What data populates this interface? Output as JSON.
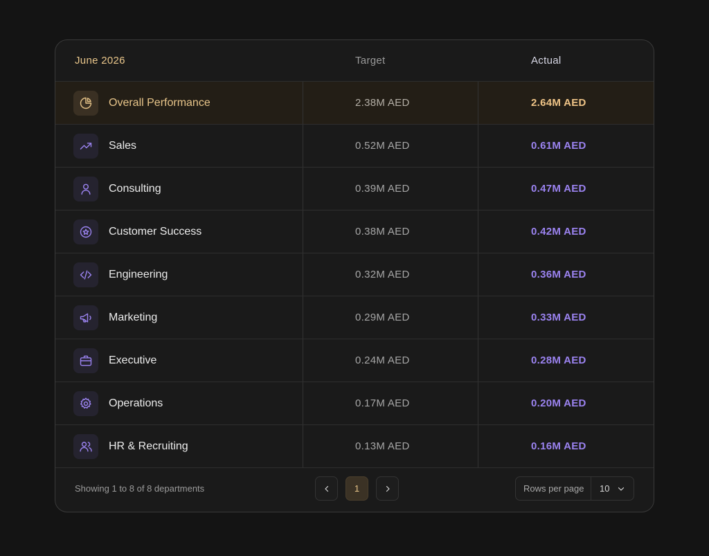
{
  "header": {
    "period": "June 2026",
    "target_label": "Target",
    "actual_label": "Actual"
  },
  "rows": [
    {
      "name": "Overall Performance",
      "target": "2.38M AED",
      "actual": "2.64M AED",
      "icon": "pie-chart-icon"
    },
    {
      "name": "Sales",
      "target": "0.52M AED",
      "actual": "0.61M AED",
      "icon": "trending-up-icon"
    },
    {
      "name": "Consulting",
      "target": "0.39M AED",
      "actual": "0.47M AED",
      "icon": "user-icon"
    },
    {
      "name": "Customer Success",
      "target": "0.38M AED",
      "actual": "0.42M AED",
      "icon": "star-badge-icon"
    },
    {
      "name": "Engineering",
      "target": "0.32M AED",
      "actual": "0.36M AED",
      "icon": "code-icon"
    },
    {
      "name": "Marketing",
      "target": "0.29M AED",
      "actual": "0.33M AED",
      "icon": "megaphone-icon"
    },
    {
      "name": "Executive",
      "target": "0.24M AED",
      "actual": "0.28M AED",
      "icon": "briefcase-icon"
    },
    {
      "name": "Operations",
      "target": "0.17M AED",
      "actual": "0.20M AED",
      "icon": "gear-icon"
    },
    {
      "name": "HR & Recruiting",
      "target": "0.13M AED",
      "actual": "0.16M AED",
      "icon": "users-icon"
    }
  ],
  "footer": {
    "showing": "Showing 1 to 8 of 8 departments",
    "current_page": "1",
    "rows_per_page_label": "Rows per page",
    "rows_per_page_value": "10"
  },
  "colors": {
    "accent_gold": "#e8c58a",
    "accent_purple": "#9b83f0",
    "background": "#141414"
  }
}
